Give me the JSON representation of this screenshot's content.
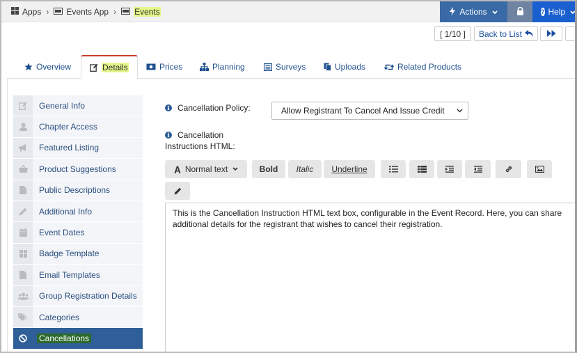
{
  "breadcrumb": {
    "items": [
      {
        "label": "Apps",
        "icon": "grid-icon"
      },
      {
        "label": "Events App",
        "icon": "card-icon"
      },
      {
        "label": "Events",
        "icon": "card-icon",
        "highlighted": true
      }
    ]
  },
  "topbar": {
    "actions_label": "Actions",
    "help_label": "Help"
  },
  "pager": {
    "count": "[ 1/10 ]",
    "back_label": "Back to List"
  },
  "tabs": [
    {
      "label": "Overview",
      "icon": "star-icon"
    },
    {
      "label": "Details",
      "icon": "edit-icon",
      "active": true
    },
    {
      "label": "Prices",
      "icon": "money-icon"
    },
    {
      "label": "Planning",
      "icon": "sitemap-icon"
    },
    {
      "label": "Surveys",
      "icon": "list-icon"
    },
    {
      "label": "Uploads",
      "icon": "copy-icon"
    },
    {
      "label": "Related Products",
      "icon": "retweet-icon"
    }
  ],
  "sidebar": {
    "items": [
      {
        "label": "General Info",
        "icon": "edit-icon"
      },
      {
        "label": "Chapter Access",
        "icon": "user-icon"
      },
      {
        "label": "Featured Listing",
        "icon": "megaphone-icon"
      },
      {
        "label": "Product Suggestions",
        "icon": "basket-icon"
      },
      {
        "label": "Public Descriptions",
        "icon": "file-icon"
      },
      {
        "label": "Additional Info",
        "icon": "pencil-icon"
      },
      {
        "label": "Event Dates",
        "icon": "calendar-icon"
      },
      {
        "label": "Badge Template",
        "icon": "grid-icon"
      },
      {
        "label": "Email Templates",
        "icon": "file-icon"
      },
      {
        "label": "Group Registration Details",
        "icon": "users-icon"
      },
      {
        "label": "Categories",
        "icon": "tags-icon"
      },
      {
        "label": "Cancellations",
        "icon": "ban-icon",
        "active": true
      }
    ]
  },
  "form": {
    "policy_label": "Cancellation Policy:",
    "policy_value": "Allow Registrant To Cancel And Issue Credit",
    "instructions_label_line1": "Cancellation",
    "instructions_label_line2": "Instructions HTML:"
  },
  "toolbar": {
    "format_label": "Normal text",
    "bold_label": "Bold",
    "italic_label": "Italic",
    "underline_label": "Underline"
  },
  "editor": {
    "content": "This is the Cancellation Instruction HTML text box, configurable in the Event Record. Here, you can share additional details for the registrant that wishes to cancel their registration."
  },
  "colors": {
    "actions_bg": "#3a6aa6",
    "help_bg": "#1a5fd0",
    "active_sidebar": "#2f5f99",
    "highlight": "#e4f58a",
    "tab_accent": "#c9402c"
  }
}
